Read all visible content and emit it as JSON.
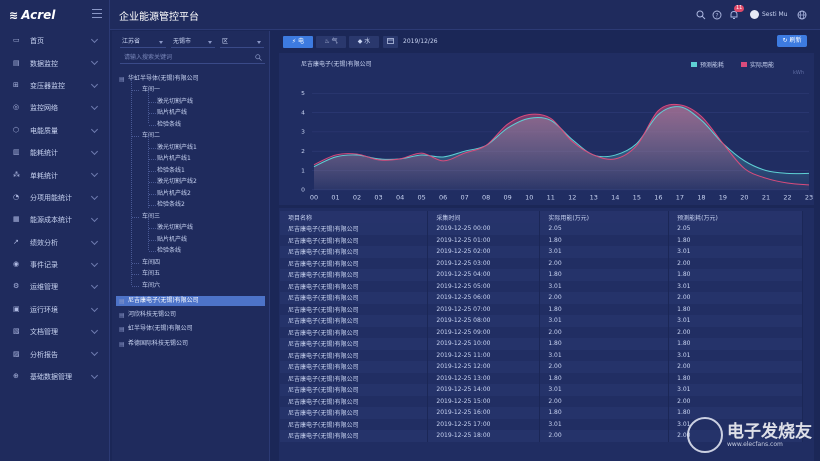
{
  "app": {
    "brand": "Acrel",
    "title": "企业能源管控平台"
  },
  "header": {
    "notification_count": "11",
    "username": "Sesti Mu"
  },
  "sidebar": {
    "items": [
      {
        "label": "首页",
        "icon": "monitor-icon"
      },
      {
        "label": "数据监控",
        "icon": "data-monitor-icon"
      },
      {
        "label": "变压器监控",
        "icon": "transformer-icon"
      },
      {
        "label": "监控网络",
        "icon": "network-icon"
      },
      {
        "label": "电能质量",
        "icon": "power-quality-icon"
      },
      {
        "label": "能耗统计",
        "icon": "bar-chart-icon"
      },
      {
        "label": "单耗统计",
        "icon": "cluster-icon"
      },
      {
        "label": "分项用能统计",
        "icon": "pie-icon"
      },
      {
        "label": "能源成本统计",
        "icon": "cost-icon"
      },
      {
        "label": "绩效分析",
        "icon": "trend-icon"
      },
      {
        "label": "事件记录",
        "icon": "event-icon"
      },
      {
        "label": "运维管理",
        "icon": "maintenance-icon"
      },
      {
        "label": "运行环境",
        "icon": "environment-icon"
      },
      {
        "label": "文档管理",
        "icon": "document-icon"
      },
      {
        "label": "分析报告",
        "icon": "report-icon"
      },
      {
        "label": "基础数据管理",
        "icon": "globe-icon"
      }
    ]
  },
  "filters": {
    "province": "江苏省",
    "city": "无锡市",
    "district": "区",
    "search_placeholder": "请输入搜索关键词"
  },
  "tree": {
    "nodes": [
      {
        "label": "华虹半导体(无锡)有限公司",
        "level": 0
      },
      {
        "label": "车间一",
        "level": 1
      },
      {
        "label": "激光切割产线",
        "level": 2
      },
      {
        "label": "贴片机产线",
        "level": 2
      },
      {
        "label": "检验条线",
        "level": 2
      },
      {
        "label": "车间二",
        "level": 1
      },
      {
        "label": "激光切割产线1",
        "level": 2
      },
      {
        "label": "贴片机产线1",
        "level": 2
      },
      {
        "label": "检验条线1",
        "level": 2
      },
      {
        "label": "激光切割产线2",
        "level": 2
      },
      {
        "label": "贴片机产线2",
        "level": 2
      },
      {
        "label": "检验条线2",
        "level": 2
      },
      {
        "label": "车间三",
        "level": 1
      },
      {
        "label": "激光切割产线",
        "level": 2
      },
      {
        "label": "贴片机产线",
        "level": 2
      },
      {
        "label": "检验条线",
        "level": 2
      },
      {
        "label": "车间四",
        "level": 1
      },
      {
        "label": "车间五",
        "level": 1
      },
      {
        "label": "车间六",
        "level": 1
      },
      {
        "label": "尼吉康电子(无锡)有限公司",
        "level": 0,
        "selected": true
      },
      {
        "label": "河欣科技无锡公司",
        "level": 0
      },
      {
        "label": "虹半导体(无锡)有限公司",
        "level": 0
      },
      {
        "label": "希德国际科技无锡公司",
        "level": 0
      }
    ]
  },
  "toolbar": {
    "tabs": [
      {
        "label": "电",
        "icon": "lightning-icon",
        "active": true
      },
      {
        "label": "气",
        "icon": "flame-icon",
        "active": false
      },
      {
        "label": "水",
        "icon": "drop-icon",
        "active": false
      }
    ],
    "calendar_icon": "calendar-icon",
    "date": "2019/12/26",
    "refresh_label": "刷新"
  },
  "chart_data": {
    "type": "area",
    "title": "尼吉康电子(无锡)有限公司",
    "unit_label": "kWh",
    "x": [
      "00",
      "01",
      "02",
      "03",
      "04",
      "05",
      "06",
      "07",
      "08",
      "09",
      "10",
      "11",
      "12",
      "13",
      "14",
      "15",
      "16",
      "17",
      "18",
      "19",
      "20",
      "21",
      "22",
      "23"
    ],
    "ylim": [
      0,
      5
    ],
    "yticks": [
      0,
      1,
      2,
      3,
      4,
      5
    ],
    "grid": true,
    "legend_position": "top-right",
    "series": [
      {
        "name": "预测能耗",
        "color": "#5ed0d4",
        "values": [
          1.2,
          1.7,
          1.8,
          1.6,
          1.6,
          1.8,
          1.7,
          2.0,
          2.3,
          3.2,
          3.7,
          3.6,
          2.6,
          1.8,
          1.8,
          2.4,
          3.9,
          4.3,
          3.6,
          2.4,
          1.5,
          1.0,
          0.85,
          0.85
        ]
      },
      {
        "name": "实际用能",
        "color": "#d94b7c",
        "values": [
          1.3,
          1.8,
          1.85,
          1.55,
          1.6,
          1.9,
          1.5,
          1.9,
          2.3,
          3.4,
          3.9,
          3.7,
          2.5,
          1.8,
          1.6,
          2.3,
          4.1,
          4.4,
          3.8,
          2.4,
          1.1,
          0.6,
          0.35,
          0.25
        ]
      }
    ]
  },
  "table": {
    "columns": [
      "项目名称",
      "采集时间",
      "实际用能(万元)",
      "预测能耗(万元)"
    ],
    "rows": [
      [
        "尼吉康电子(无锡)有限公司",
        "2019-12-25   00:00",
        "2.05",
        "2.05"
      ],
      [
        "尼吉康电子(无锡)有限公司",
        "2019-12-25   01:00",
        "1.80",
        "1.80"
      ],
      [
        "尼吉康电子(无锡)有限公司",
        "2019-12-25   02:00",
        "3.01",
        "3.01"
      ],
      [
        "尼吉康电子(无锡)有限公司",
        "2019-12-25   03:00",
        "2.00",
        "2.00"
      ],
      [
        "尼吉康电子(无锡)有限公司",
        "2019-12-25   04:00",
        "1.80",
        "1.80"
      ],
      [
        "尼吉康电子(无锡)有限公司",
        "2019-12-25   05:00",
        "3.01",
        "3.01"
      ],
      [
        "尼吉康电子(无锡)有限公司",
        "2019-12-25   06:00",
        "2.00",
        "2.00"
      ],
      [
        "尼吉康电子(无锡)有限公司",
        "2019-12-25   07:00",
        "1.80",
        "1.80"
      ],
      [
        "尼吉康电子(无锡)有限公司",
        "2019-12-25   08:00",
        "3.01",
        "3.01"
      ],
      [
        "尼吉康电子(无锡)有限公司",
        "2019-12-25   09:00",
        "2.00",
        "2.00"
      ],
      [
        "尼吉康电子(无锡)有限公司",
        "2019-12-25   10:00",
        "1.80",
        "1.80"
      ],
      [
        "尼吉康电子(无锡)有限公司",
        "2019-12-25   11:00",
        "3.01",
        "3.01"
      ],
      [
        "尼吉康电子(无锡)有限公司",
        "2019-12-25   12:00",
        "2.00",
        "2.00"
      ],
      [
        "尼吉康电子(无锡)有限公司",
        "2019-12-25   13:00",
        "1.80",
        "1.80"
      ],
      [
        "尼吉康电子(无锡)有限公司",
        "2019-12-25   14:00",
        "3.01",
        "3.01"
      ],
      [
        "尼吉康电子(无锡)有限公司",
        "2019-12-25   15:00",
        "2.00",
        "2.00"
      ],
      [
        "尼吉康电子(无锡)有限公司",
        "2019-12-25   16:00",
        "1.80",
        "1.80"
      ],
      [
        "尼吉康电子(无锡)有限公司",
        "2019-12-25   17:00",
        "3.01",
        "3.01"
      ],
      [
        "尼吉康电子(无锡)有限公司",
        "2019-12-25   18:00",
        "2.00",
        "2.00"
      ]
    ]
  },
  "watermark": {
    "text": "电子发烧友",
    "sub": "www.elecfans.com"
  }
}
